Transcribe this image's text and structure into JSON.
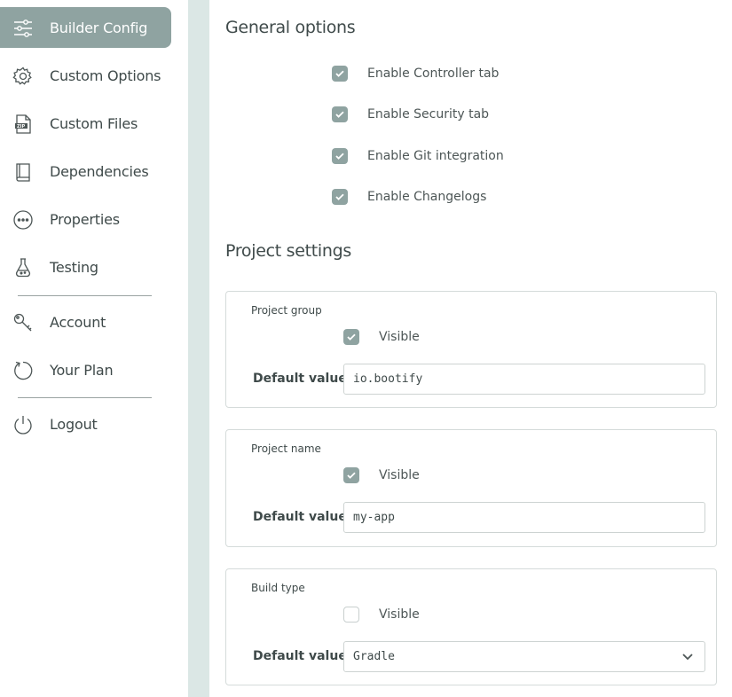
{
  "sidebar": {
    "items": [
      {
        "label": "Builder Config",
        "icon": "sliders-icon",
        "active": true
      },
      {
        "label": "Custom Options",
        "icon": "gear-icon"
      },
      {
        "label": "Custom Files",
        "icon": "zip-file-icon"
      },
      {
        "label": "Dependencies",
        "icon": "book-icon"
      },
      {
        "label": "Properties",
        "icon": "dots-circle-icon"
      },
      {
        "label": "Testing",
        "icon": "flask-icon"
      },
      {
        "label": "Account",
        "icon": "key-icon"
      },
      {
        "label": "Your Plan",
        "icon": "refresh-icon"
      },
      {
        "label": "Logout",
        "icon": "power-icon"
      }
    ]
  },
  "general": {
    "title": "General options",
    "options": [
      {
        "label": "Enable Controller tab",
        "checked": true
      },
      {
        "label": "Enable Security tab",
        "checked": true
      },
      {
        "label": "Enable Git integration",
        "checked": true
      },
      {
        "label": "Enable Changelogs",
        "checked": true
      }
    ]
  },
  "project": {
    "title": "Project settings",
    "default_value_label": "Default value",
    "visible_label": "Visible",
    "cards": [
      {
        "title": "Project group",
        "visible": true,
        "value": "io.bootify"
      },
      {
        "title": "Project name",
        "visible": true,
        "value": "my-app"
      },
      {
        "title": "Build type",
        "visible": false,
        "value": "Gradle"
      }
    ]
  },
  "colors": {
    "accent": "#8fa3a1",
    "rail": "#dbe7e5",
    "text": "#3f4a4a"
  }
}
